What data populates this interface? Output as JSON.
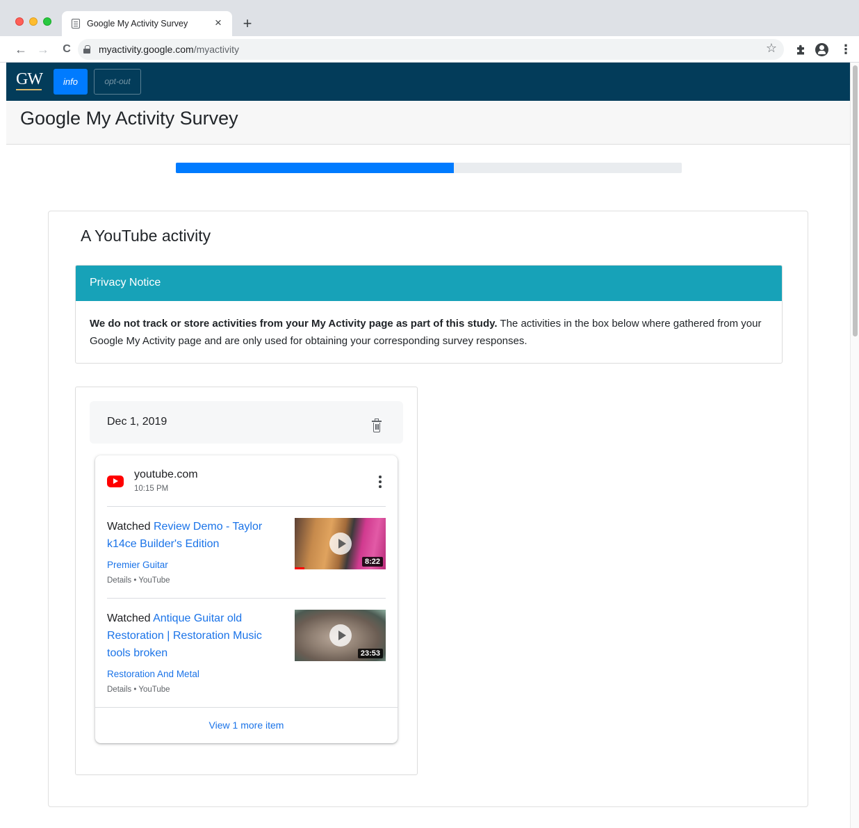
{
  "browser": {
    "tab_title": "Google My Activity Survey",
    "tab_close": "×",
    "new_tab": "+",
    "url_host": "myactivity.google.com",
    "url_path": "/myactivity",
    "back": "←",
    "forward": "→",
    "reload": "C",
    "bookmark": "☆",
    "more": "⋮",
    "icons": [
      "document-icon",
      "lock-icon",
      "star-icon",
      "extensions-icon",
      "profile-icon"
    ]
  },
  "appnav": {
    "logo": "GW",
    "info_label": "info",
    "optout_label": "opt-out"
  },
  "page": {
    "title": "Google My Activity Survey",
    "progress_percent": 55
  },
  "card": {
    "title": "A YouTube activity",
    "notice": {
      "heading": "Privacy Notice",
      "bold": "We do not track or store activities from your My Activity page as part of this study.",
      "text": " The activities in the box below where gathered from your Google My Activity page and are only used for obtaining your corresponding survey responses."
    }
  },
  "activity": {
    "date": "Dec 1, 2019",
    "site": "youtube.com",
    "time": "10:15 PM",
    "items": [
      {
        "verb": "Watched ",
        "title": "Review Demo - Taylor k14ce Builder's Edition",
        "channel": "Premier Guitar",
        "details": "Details • YouTube",
        "duration": "8:22"
      },
      {
        "verb": "Watched ",
        "title": "Antique Guitar old Restoration | Restoration Music tools broken",
        "channel": "Restoration And Metal",
        "details": "Details • YouTube",
        "duration": "23:53"
      }
    ],
    "view_more": "View 1 more item"
  },
  "colors": {
    "nav_bg": "#033c5a",
    "primary": "#007bff",
    "notice_head": "#17a2b8",
    "link": "#1a73e8",
    "youtube_red": "#ff0000"
  }
}
